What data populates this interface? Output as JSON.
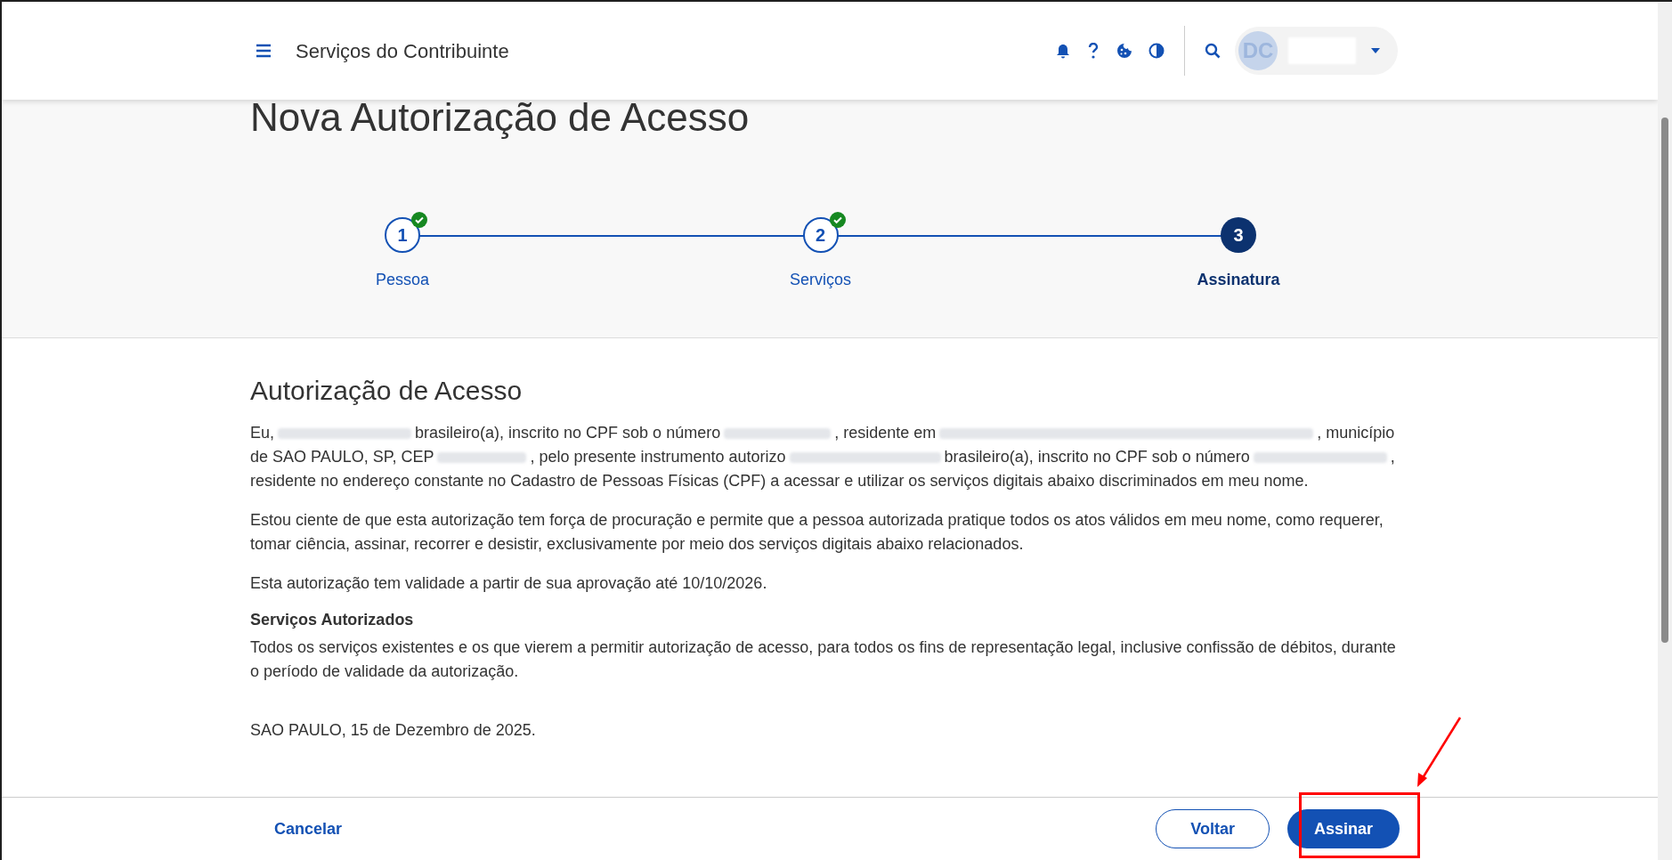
{
  "header": {
    "title": "Serviços do Contribuinte",
    "avatar_initials": "DC"
  },
  "page_title": "Nova Autorização de Acesso",
  "steps": [
    {
      "number": "1",
      "label": "Pessoa",
      "done": true,
      "selected": false
    },
    {
      "number": "2",
      "label": "Serviços",
      "done": true,
      "selected": false
    },
    {
      "number": "3",
      "label": "Assinatura",
      "done": false,
      "selected": true
    }
  ],
  "section_title": "Autorização de Acesso",
  "intro_segments": [
    "Eu,",
    "brasileiro(a), inscrito no CPF sob o número",
    ", residente em",
    ", município de SAO PAULO, SP, CEP",
    ", pelo presente instrumento autorizo",
    "brasileiro(a), inscrito no CPF sob o número",
    ", residente no endereço constante no Cadastro de Pessoas Físicas (CPF) a acessar e utilizar os serviços digitais abaixo discriminados em meu nome."
  ],
  "paragraphs": [
    "Estou ciente de que esta autorização tem força de procuração e permite que a pessoa autorizada pratique todos os atos válidos em meu nome, como requerer, tomar ciência, assinar, recorrer e desistir, exclusivamente por meio dos serviços digitais abaixo relacionados.",
    "Esta autorização tem validade a partir de sua aprovação até 10/10/2026."
  ],
  "services_heading": "Serviços Autorizados",
  "services_text": "Todos os serviços existentes e os que vierem a permitir autorização de acesso, para todos os fins de representação legal, inclusive confissão de débitos, durante o período de validade da autorização.",
  "place_date": "SAO PAULO, 15 de Dezembro de 2025.",
  "footer": {
    "cancel": "Cancelar",
    "back": "Voltar",
    "sign": "Assinar"
  },
  "annotations": [
    {
      "kind": "highlight-box"
    },
    {
      "kind": "arrow"
    }
  ]
}
